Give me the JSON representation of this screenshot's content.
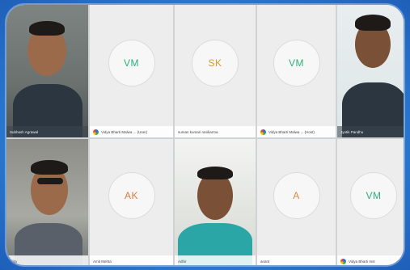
{
  "participants": [
    {
      "type": "video",
      "name": "Subhash Agrawal",
      "initials": ""
    },
    {
      "type": "avatar",
      "name": "Vidya Bharti Malwa ... (User)",
      "initials": "VM",
      "initials_color": "#2eb07a",
      "show_icon": true
    },
    {
      "type": "avatar",
      "name": "suman kumari ranikarma",
      "initials": "SK",
      "initials_color": "#d39a2c",
      "show_icon": false
    },
    {
      "type": "avatar",
      "name": "Vidya Bharti Malwa ... (Host)",
      "initials": "VM",
      "initials_color": "#2eb07a",
      "show_icon": true
    },
    {
      "type": "video",
      "name": "Jyotik Pandhu",
      "initials": ""
    },
    {
      "type": "video",
      "name": "Ajita",
      "initials": ""
    },
    {
      "type": "avatar",
      "name": "Amit Mehta",
      "initials": "AK",
      "initials_color": "#e07a3a",
      "show_icon": false
    },
    {
      "type": "video",
      "name": "Adhir",
      "initials": ""
    },
    {
      "type": "avatar",
      "name": "anant",
      "initials": "A",
      "initials_color": "#e0893a",
      "show_icon": false
    },
    {
      "type": "avatar",
      "name": "Vidya Bharti Inst",
      "initials": "VM",
      "initials_color": "#2eb07a",
      "show_icon": true
    }
  ]
}
